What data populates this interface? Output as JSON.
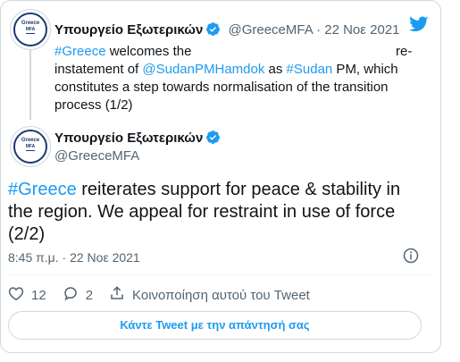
{
  "parent_tweet": {
    "author_name": "Υπουργείο Εξωτερικών",
    "handle": "@GreeceMFA",
    "separator": " · ",
    "date": "22 Νοε 2021",
    "text_parts": {
      "p1": "#Greece",
      "p2": " welcomes the",
      "p3": "re-",
      "p4": "instatement of ",
      "p5": "@SudanPMHamdok",
      "p6": " as ",
      "p7": "#Sudan",
      "p8": " PM, which constitutes a step towards normalisation of the transition process (1/2)"
    }
  },
  "avatar": {
    "line1": "Greece",
    "line2": "MFA"
  },
  "main_tweet": {
    "author_name": "Υπουργείο Εξωτερικών",
    "handle": "@GreeceMFA",
    "text_hashtag": "#Greece",
    "text_rest": " reiterates support for peace & stability in the region. We appeal for restraint in use of force (2/2)",
    "timestamp": "8:45 π.μ. · 22 Νοε 2021"
  },
  "actions": {
    "likes": "12",
    "replies": "2",
    "share_label": "Κοινοποίηση αυτού του Tweet"
  },
  "reply_button_label": "Κάντε Tweet με την απάντησή σας",
  "colors": {
    "accent": "#1d9bf0",
    "text": "#0f1419",
    "muted": "#536471",
    "border": "#cfd9de",
    "brand_navy": "#1e3a6e"
  }
}
